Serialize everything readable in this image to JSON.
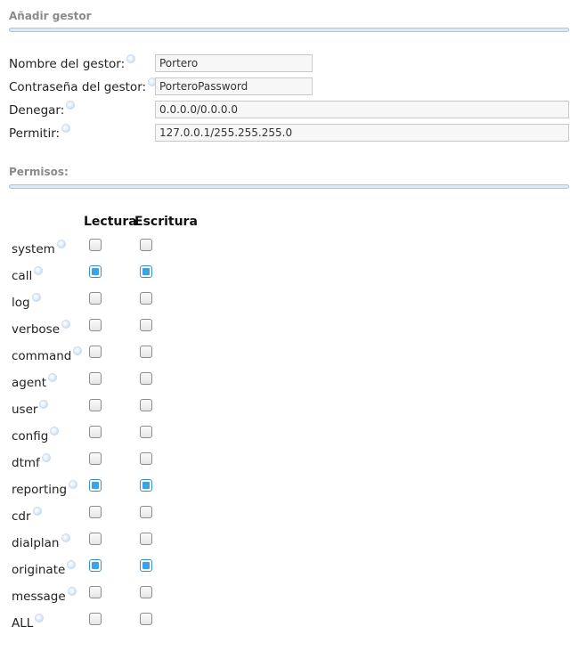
{
  "add_manager": {
    "title": "Añadir gestor",
    "fields": [
      {
        "label": "Nombre del gestor:",
        "value": "Portero"
      },
      {
        "label": "Contraseña del gestor:",
        "value": "PorteroPassword"
      },
      {
        "label": "Denegar:",
        "value": "0.0.0.0/0.0.0.0"
      },
      {
        "label": "Permitir:",
        "value": "127.0.0.1/255.255.255.0"
      }
    ]
  },
  "permissions": {
    "title": "Permisos:",
    "read_header": "Lectura",
    "write_header": "Escritura",
    "rows": [
      {
        "name": "system",
        "read": false,
        "write": false
      },
      {
        "name": "call",
        "read": true,
        "write": true
      },
      {
        "name": "log",
        "read": false,
        "write": false
      },
      {
        "name": "verbose",
        "read": false,
        "write": false
      },
      {
        "name": "command",
        "read": false,
        "write": false
      },
      {
        "name": "agent",
        "read": false,
        "write": false
      },
      {
        "name": "user",
        "read": false,
        "write": false
      },
      {
        "name": "config",
        "read": false,
        "write": false
      },
      {
        "name": "dtmf",
        "read": false,
        "write": false
      },
      {
        "name": "reporting",
        "read": true,
        "write": true
      },
      {
        "name": "cdr",
        "read": false,
        "write": false
      },
      {
        "name": "dialplan",
        "read": false,
        "write": false
      },
      {
        "name": "originate",
        "read": true,
        "write": true
      },
      {
        "name": "message",
        "read": false,
        "write": false
      },
      {
        "name": "ALL",
        "read": false,
        "write": false
      }
    ]
  },
  "colors": {
    "checked_fill": "#3aa3ec",
    "section_bar": "#dbe9f6"
  }
}
